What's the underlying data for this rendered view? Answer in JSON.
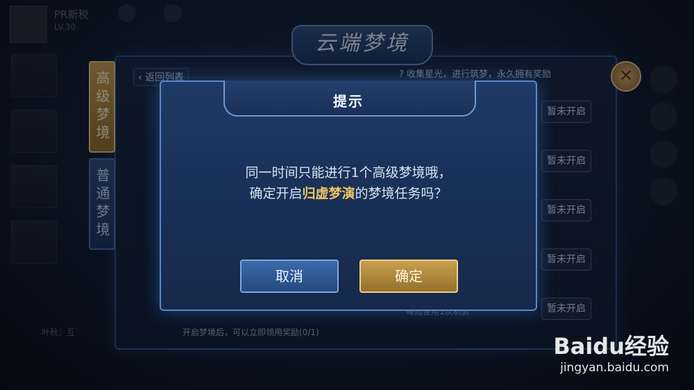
{
  "player": {
    "name": "PR新税",
    "level": "LV.30"
  },
  "dream_title": "云端梦境",
  "tabs": {
    "advanced": "高级梦境",
    "normal": "普通梦境"
  },
  "back_label": "返回列表",
  "hint": "收集星光，进行筑梦，永久拥有奖励",
  "task_buttons": [
    "暂未开启",
    "暂未开启",
    "暂未开启",
    "暂未开启",
    "暂未开启"
  ],
  "footer_text": "开启梦境后，可以立即领用奖励(0/1)",
  "weekly_text": "每周使用1次机会",
  "bottom_left": "叶秋：互",
  "modal": {
    "title": "提示",
    "message_line1": "同一时间只能进行1个高级梦境哦，",
    "message_line2_prefix": "确定开启",
    "message_highlight": "归虚梦演",
    "message_line2_suffix": "的梦境任务吗？",
    "cancel_label": "取消",
    "confirm_label": "确定"
  },
  "watermark": {
    "logo": "Baidu经验",
    "url": "jingyan.baidu.com"
  },
  "colors": {
    "highlight": "#f0c464",
    "confirm": "#c9a04e",
    "cancel": "#3b6aaa"
  }
}
